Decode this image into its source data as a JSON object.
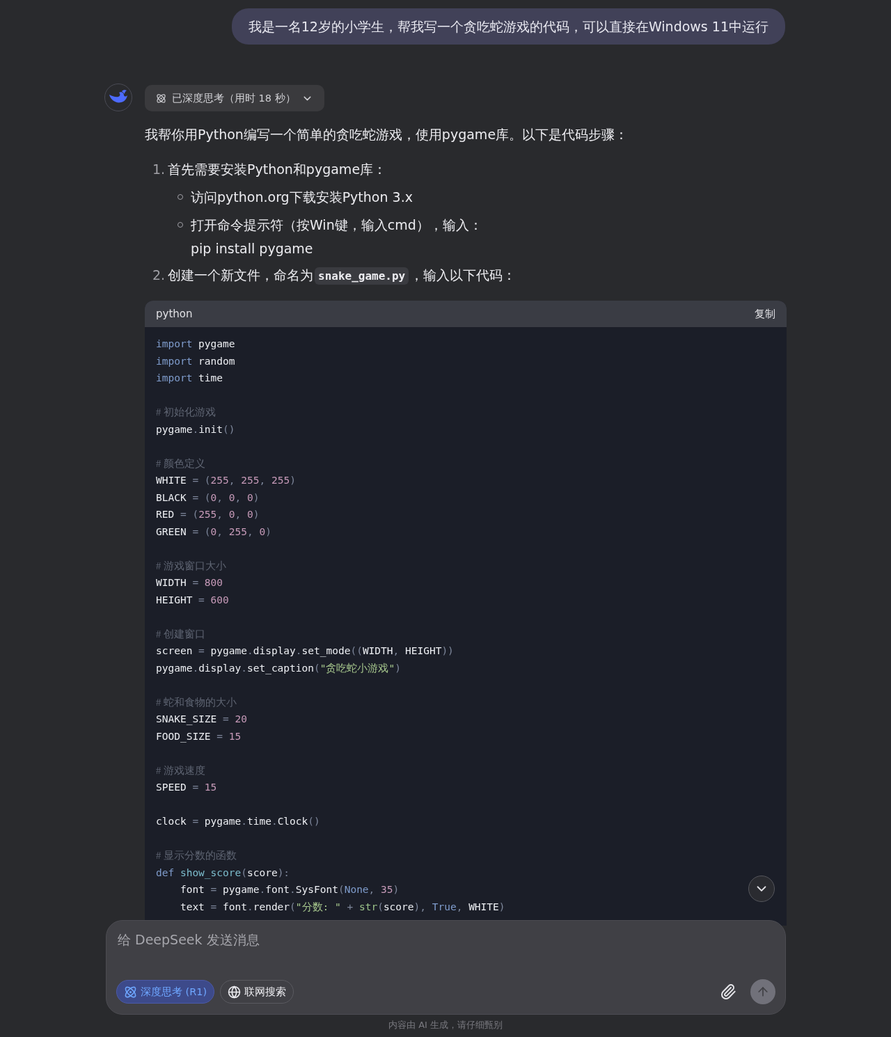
{
  "user_message": "我是一名12岁的小学生，帮我写一个贪吃蛇游戏的代码，可以直接在Windows 11中运行",
  "thinking": {
    "label": "已深度思考（用时 18 秒）",
    "expanded": false
  },
  "answer": {
    "intro": "我帮你用Python编写一个简单的贪吃蛇游戏，使用pygame库。以下是代码步骤：",
    "steps": [
      {
        "number": "1.",
        "text": "首先需要安装Python和pygame库：",
        "bullets": [
          {
            "text": "访问python.org下载安装Python 3.x"
          },
          {
            "text": "打开命令提示符（按Win键，输入cmd），输入：",
            "continuation": "pip install pygame"
          }
        ]
      },
      {
        "number": "2.",
        "text": "创建一个新文件，命名为",
        "inline_code": "snake_game.py",
        "text_after": "，输入以下代码："
      }
    ]
  },
  "code_block": {
    "language": "python",
    "copy_label": "复制",
    "lines": [
      {
        "kind": "code",
        "tokens": [
          {
            "kind": "kw",
            "text": "import"
          },
          {
            "kind": "name",
            "text": " pygame"
          }
        ]
      },
      {
        "kind": "code",
        "tokens": [
          {
            "kind": "kw",
            "text": "import"
          },
          {
            "kind": "name",
            "text": " random"
          }
        ]
      },
      {
        "kind": "code",
        "tokens": [
          {
            "kind": "kw",
            "text": "import"
          },
          {
            "kind": "name",
            "text": " time"
          }
        ]
      },
      {
        "kind": "blank"
      },
      {
        "kind": "code",
        "tokens": [
          {
            "kind": "com",
            "text": "# 初始化游戏"
          }
        ]
      },
      {
        "kind": "code",
        "tokens": [
          {
            "kind": "name",
            "text": "pygame"
          },
          {
            "kind": "op",
            "text": "."
          },
          {
            "kind": "name",
            "text": "init"
          },
          {
            "kind": "op",
            "text": "()"
          }
        ]
      },
      {
        "kind": "blank"
      },
      {
        "kind": "code",
        "tokens": [
          {
            "kind": "com",
            "text": "# 颜色定义"
          }
        ]
      },
      {
        "kind": "code",
        "tokens": [
          {
            "kind": "name",
            "text": "WHITE"
          },
          {
            "kind": "op",
            "text": " = ("
          },
          {
            "kind": "num",
            "text": "255"
          },
          {
            "kind": "op",
            "text": ", "
          },
          {
            "kind": "num",
            "text": "255"
          },
          {
            "kind": "op",
            "text": ", "
          },
          {
            "kind": "num",
            "text": "255"
          },
          {
            "kind": "op",
            "text": ")"
          }
        ]
      },
      {
        "kind": "code",
        "tokens": [
          {
            "kind": "name",
            "text": "BLACK"
          },
          {
            "kind": "op",
            "text": " = ("
          },
          {
            "kind": "num",
            "text": "0"
          },
          {
            "kind": "op",
            "text": ", "
          },
          {
            "kind": "num",
            "text": "0"
          },
          {
            "kind": "op",
            "text": ", "
          },
          {
            "kind": "num",
            "text": "0"
          },
          {
            "kind": "op",
            "text": ")"
          }
        ]
      },
      {
        "kind": "code",
        "tokens": [
          {
            "kind": "name",
            "text": "RED"
          },
          {
            "kind": "op",
            "text": " = ("
          },
          {
            "kind": "num",
            "text": "255"
          },
          {
            "kind": "op",
            "text": ", "
          },
          {
            "kind": "num",
            "text": "0"
          },
          {
            "kind": "op",
            "text": ", "
          },
          {
            "kind": "num",
            "text": "0"
          },
          {
            "kind": "op",
            "text": ")"
          }
        ]
      },
      {
        "kind": "code",
        "tokens": [
          {
            "kind": "name",
            "text": "GREEN"
          },
          {
            "kind": "op",
            "text": " = ("
          },
          {
            "kind": "num",
            "text": "0"
          },
          {
            "kind": "op",
            "text": ", "
          },
          {
            "kind": "num",
            "text": "255"
          },
          {
            "kind": "op",
            "text": ", "
          },
          {
            "kind": "num",
            "text": "0"
          },
          {
            "kind": "op",
            "text": ")"
          }
        ]
      },
      {
        "kind": "blank"
      },
      {
        "kind": "code",
        "tokens": [
          {
            "kind": "com",
            "text": "# 游戏窗口大小"
          }
        ]
      },
      {
        "kind": "code",
        "tokens": [
          {
            "kind": "name",
            "text": "WIDTH"
          },
          {
            "kind": "op",
            "text": " = "
          },
          {
            "kind": "num",
            "text": "800"
          }
        ]
      },
      {
        "kind": "code",
        "tokens": [
          {
            "kind": "name",
            "text": "HEIGHT"
          },
          {
            "kind": "op",
            "text": " = "
          },
          {
            "kind": "num",
            "text": "600"
          }
        ]
      },
      {
        "kind": "blank"
      },
      {
        "kind": "code",
        "tokens": [
          {
            "kind": "com",
            "text": "# 创建窗口"
          }
        ]
      },
      {
        "kind": "code",
        "tokens": [
          {
            "kind": "name",
            "text": "screen"
          },
          {
            "kind": "op",
            "text": " = "
          },
          {
            "kind": "name",
            "text": "pygame"
          },
          {
            "kind": "op",
            "text": "."
          },
          {
            "kind": "name",
            "text": "display"
          },
          {
            "kind": "op",
            "text": "."
          },
          {
            "kind": "name",
            "text": "set_mode"
          },
          {
            "kind": "op",
            "text": "(("
          },
          {
            "kind": "name",
            "text": "WIDTH"
          },
          {
            "kind": "op",
            "text": ", "
          },
          {
            "kind": "name",
            "text": "HEIGHT"
          },
          {
            "kind": "op",
            "text": "))"
          }
        ]
      },
      {
        "kind": "code",
        "tokens": [
          {
            "kind": "name",
            "text": "pygame"
          },
          {
            "kind": "op",
            "text": "."
          },
          {
            "kind": "name",
            "text": "display"
          },
          {
            "kind": "op",
            "text": "."
          },
          {
            "kind": "name",
            "text": "set_caption"
          },
          {
            "kind": "op",
            "text": "("
          },
          {
            "kind": "str",
            "text": "\"贪吃蛇小游戏\""
          },
          {
            "kind": "op",
            "text": ")"
          }
        ]
      },
      {
        "kind": "blank"
      },
      {
        "kind": "code",
        "tokens": [
          {
            "kind": "com",
            "text": "# 蛇和食物的大小"
          }
        ]
      },
      {
        "kind": "code",
        "tokens": [
          {
            "kind": "name",
            "text": "SNAKE_SIZE"
          },
          {
            "kind": "op",
            "text": " = "
          },
          {
            "kind": "num",
            "text": "20"
          }
        ]
      },
      {
        "kind": "code",
        "tokens": [
          {
            "kind": "name",
            "text": "FOOD_SIZE"
          },
          {
            "kind": "op",
            "text": " = "
          },
          {
            "kind": "num",
            "text": "15"
          }
        ]
      },
      {
        "kind": "blank"
      },
      {
        "kind": "code",
        "tokens": [
          {
            "kind": "com",
            "text": "# 游戏速度"
          }
        ]
      },
      {
        "kind": "code",
        "tokens": [
          {
            "kind": "name",
            "text": "SPEED"
          },
          {
            "kind": "op",
            "text": " = "
          },
          {
            "kind": "num",
            "text": "15"
          }
        ]
      },
      {
        "kind": "blank"
      },
      {
        "kind": "code",
        "tokens": [
          {
            "kind": "name",
            "text": "clock"
          },
          {
            "kind": "op",
            "text": " = "
          },
          {
            "kind": "name",
            "text": "pygame"
          },
          {
            "kind": "op",
            "text": "."
          },
          {
            "kind": "name",
            "text": "time"
          },
          {
            "kind": "op",
            "text": "."
          },
          {
            "kind": "name",
            "text": "Clock"
          },
          {
            "kind": "op",
            "text": "()"
          }
        ]
      },
      {
        "kind": "blank"
      },
      {
        "kind": "code",
        "tokens": [
          {
            "kind": "com",
            "text": "# 显示分数的函数"
          }
        ]
      },
      {
        "kind": "code",
        "tokens": [
          {
            "kind": "kw",
            "text": "def"
          },
          {
            "kind": "fn",
            "text": " show_score"
          },
          {
            "kind": "op",
            "text": "("
          },
          {
            "kind": "name",
            "text": "score"
          },
          {
            "kind": "op",
            "text": "):"
          }
        ]
      },
      {
        "kind": "code",
        "tokens": [
          {
            "kind": "name",
            "text": "    font"
          },
          {
            "kind": "op",
            "text": " = "
          },
          {
            "kind": "name",
            "text": "pygame"
          },
          {
            "kind": "op",
            "text": "."
          },
          {
            "kind": "name",
            "text": "font"
          },
          {
            "kind": "op",
            "text": "."
          },
          {
            "kind": "name",
            "text": "SysFont"
          },
          {
            "kind": "op",
            "text": "("
          },
          {
            "kind": "kw",
            "text": "None"
          },
          {
            "kind": "op",
            "text": ", "
          },
          {
            "kind": "num",
            "text": "35"
          },
          {
            "kind": "op",
            "text": ")"
          }
        ]
      },
      {
        "kind": "code",
        "tokens": [
          {
            "kind": "name",
            "text": "    text"
          },
          {
            "kind": "op",
            "text": " = "
          },
          {
            "kind": "name",
            "text": "font"
          },
          {
            "kind": "op",
            "text": "."
          },
          {
            "kind": "name",
            "text": "render"
          },
          {
            "kind": "op",
            "text": "("
          },
          {
            "kind": "str",
            "text": "\"分数: \""
          },
          {
            "kind": "op",
            "text": " + "
          },
          {
            "kind": "builtin",
            "text": "str"
          },
          {
            "kind": "op",
            "text": "("
          },
          {
            "kind": "name",
            "text": "score"
          },
          {
            "kind": "op",
            "text": "), "
          },
          {
            "kind": "kw",
            "text": "True"
          },
          {
            "kind": "op",
            "text": ", "
          },
          {
            "kind": "name",
            "text": "WHITE"
          },
          {
            "kind": "op",
            "text": ")"
          }
        ]
      }
    ]
  },
  "composer": {
    "placeholder": "给 DeepSeek 发送消息",
    "toggles": [
      {
        "kind": "think",
        "label": "深度思考 (R1)",
        "selected": true
      },
      {
        "kind": "search",
        "label": "联网搜索",
        "selected": false
      }
    ]
  },
  "disclaimer": "内容由 AI 生成，请仔细甄别"
}
